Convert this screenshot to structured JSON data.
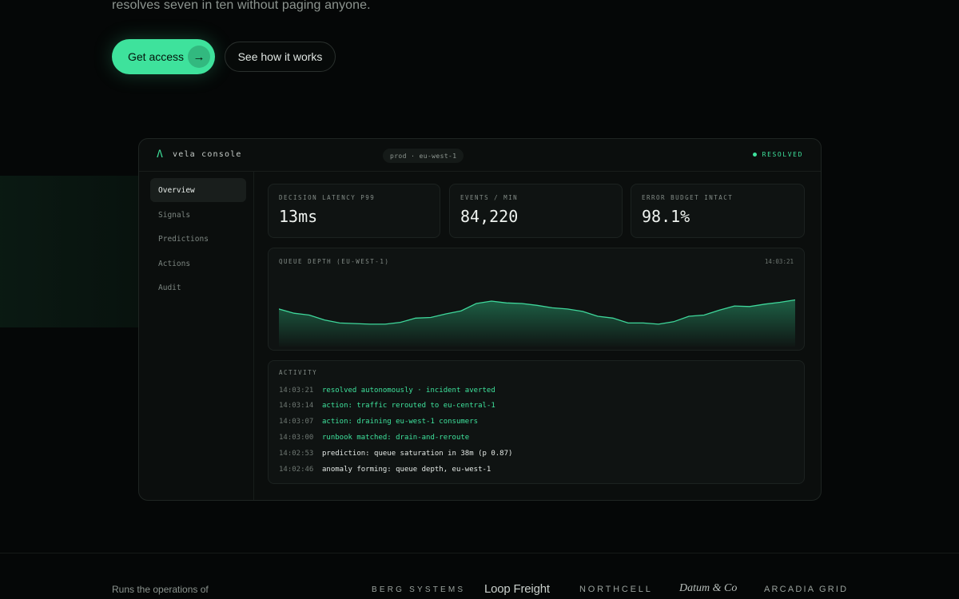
{
  "hero": {
    "subtitle": "resolves seven in ten without paging anyone.",
    "primary_button": "Get access",
    "primary_arrow": "→",
    "secondary_button": "See how it works"
  },
  "console": {
    "logo": "Λ",
    "title": "vela console",
    "env": "prod · eu-west-1",
    "status": "RESOLVED",
    "sidebar": [
      "Overview",
      "Signals",
      "Predictions",
      "Actions",
      "Audit"
    ],
    "stats": [
      {
        "label": "DECISION LATENCY P99",
        "value": "13ms"
      },
      {
        "label": "EVENTS / MIN",
        "value": "84,220"
      },
      {
        "label": "ERROR BUDGET INTACT",
        "value": "98.1%"
      }
    ],
    "chart": {
      "label": "QUEUE DEPTH (EU-WEST-1)",
      "time": "14:03:21"
    },
    "activity": {
      "label": "ACTIVITY",
      "rows": [
        {
          "time": "14:03:21",
          "text": "resolved autonomously · incident averted",
          "highlight": true
        },
        {
          "time": "14:03:14",
          "text": "action: traffic rerouted to eu-central-1",
          "highlight": true
        },
        {
          "time": "14:03:07",
          "text": "action: draining eu-west-1 consumers",
          "highlight": true
        },
        {
          "time": "14:03:00",
          "text": "runbook matched: drain-and-reroute",
          "highlight": true
        },
        {
          "time": "14:02:53",
          "text": "prediction: queue saturation in 38m (p 0.87)",
          "highlight": false
        },
        {
          "time": "14:02:46",
          "text": "anomaly forming: queue depth, eu-west-1",
          "highlight": false
        }
      ]
    }
  },
  "footer": {
    "runs_label": "Runs the operations of",
    "brands": [
      "BERG SYSTEMS",
      "Loop Freight",
      "NORTHCELL",
      "Datum & Co",
      "ARCADIA GRID"
    ]
  },
  "colors": {
    "accent": "#3ee29c",
    "background": "#050707",
    "panel": "#0b0e0d"
  },
  "chart_data": {
    "type": "area",
    "title": "QUEUE DEPTH (EU-WEST-1)",
    "xlabel": "",
    "ylabel": "",
    "x": [
      0,
      1,
      2,
      3,
      4,
      5,
      6,
      7,
      8,
      9,
      10,
      11,
      12,
      13,
      14,
      15,
      16,
      17,
      18,
      19,
      20,
      21,
      22,
      23,
      24,
      25,
      26,
      27,
      28,
      29,
      30,
      31,
      32,
      33,
      34
    ],
    "values": [
      62,
      55,
      52,
      44,
      39,
      38,
      37,
      37,
      40,
      47,
      48,
      54,
      59,
      71,
      75,
      72,
      71,
      68,
      64,
      62,
      58,
      50,
      47,
      39,
      39,
      37,
      41,
      50,
      52,
      60,
      67,
      66,
      70,
      73,
      77
    ],
    "ylim": [
      0,
      100
    ]
  }
}
